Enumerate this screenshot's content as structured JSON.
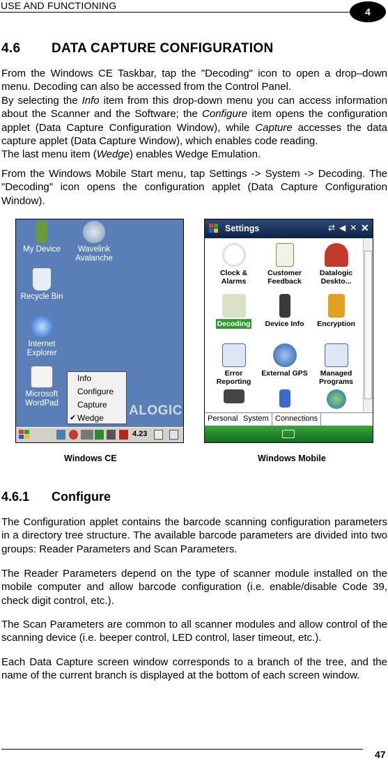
{
  "header": {
    "title": "USE AND FUNCTIONING",
    "chapter": "4"
  },
  "section": {
    "number": "4.6",
    "title": "DATA CAPTURE CONFIGURATION"
  },
  "p1": {
    "a": "From the Windows CE Taskbar, tap the \"Decoding\" icon to open a drop–down menu. Decoding can also be accessed from the Control Panel.",
    "b1": "By selecting the ",
    "b_info": "Info",
    "b2": " item from this drop-down menu you can access information about the Scanner and the Software; the ",
    "b_conf": "Configure",
    "b3": " item opens the configuration applet (Data Capture Configuration Window), while ",
    "b_cap": "Capture",
    "b4": " accesses the data capture applet (Data Capture Window), which enables code reading.",
    "c1": "The last menu item (",
    "c_wedge": "Wedge",
    "c2": ") enables Wedge Emulation."
  },
  "p2": "From the Windows Mobile Start menu, tap Settings -> System -> Decoding. The \"Decoding\" icon opens the configuration applet (Data Capture Configuration Window).",
  "ce_screen": {
    "icons": [
      "My Device",
      "Wavelink Avalanche",
      "Recycle Bin",
      "Internet Explorer",
      "Microsoft WordPad"
    ],
    "menu": [
      "Info",
      "Configure",
      "Capture",
      "Wedge"
    ],
    "logo": "ALOGIC",
    "clock": "4.23"
  },
  "wm_screen": {
    "title": "Settings",
    "items": [
      "Clock & Alarms",
      "Customer Feedback",
      "Datalogic Deskto...",
      "Decoding",
      "Device Info",
      "Encryption",
      "Error Reporting",
      "External GPS",
      "Managed Programs"
    ],
    "tabs": [
      "Personal",
      "System",
      "Connections"
    ]
  },
  "captions": {
    "ce": "Windows CE",
    "wm": "Windows Mobile"
  },
  "subsection": {
    "number": "4.6.1",
    "title": "Configure"
  },
  "p3": "The Configuration applet contains the barcode scanning configuration parameters in a directory tree structure. The available barcode parameters are divided into two groups: Reader Parameters and Scan Parameters.",
  "p4": "The Reader Parameters depend on the type of scanner module installed on the mobile computer and allow barcode configuration (i.e. enable/disable Code 39, check digit control, etc.).",
  "p5": "The Scan Parameters are common to all scanner modules and allow control of the scanning device (i.e. beeper control, LED control, laser timeout, etc.).",
  "p6": "Each Data Capture screen window corresponds to a branch of the tree, and the name of the current branch is displayed at the bottom of each screen window.",
  "footer": {
    "page": "47"
  }
}
